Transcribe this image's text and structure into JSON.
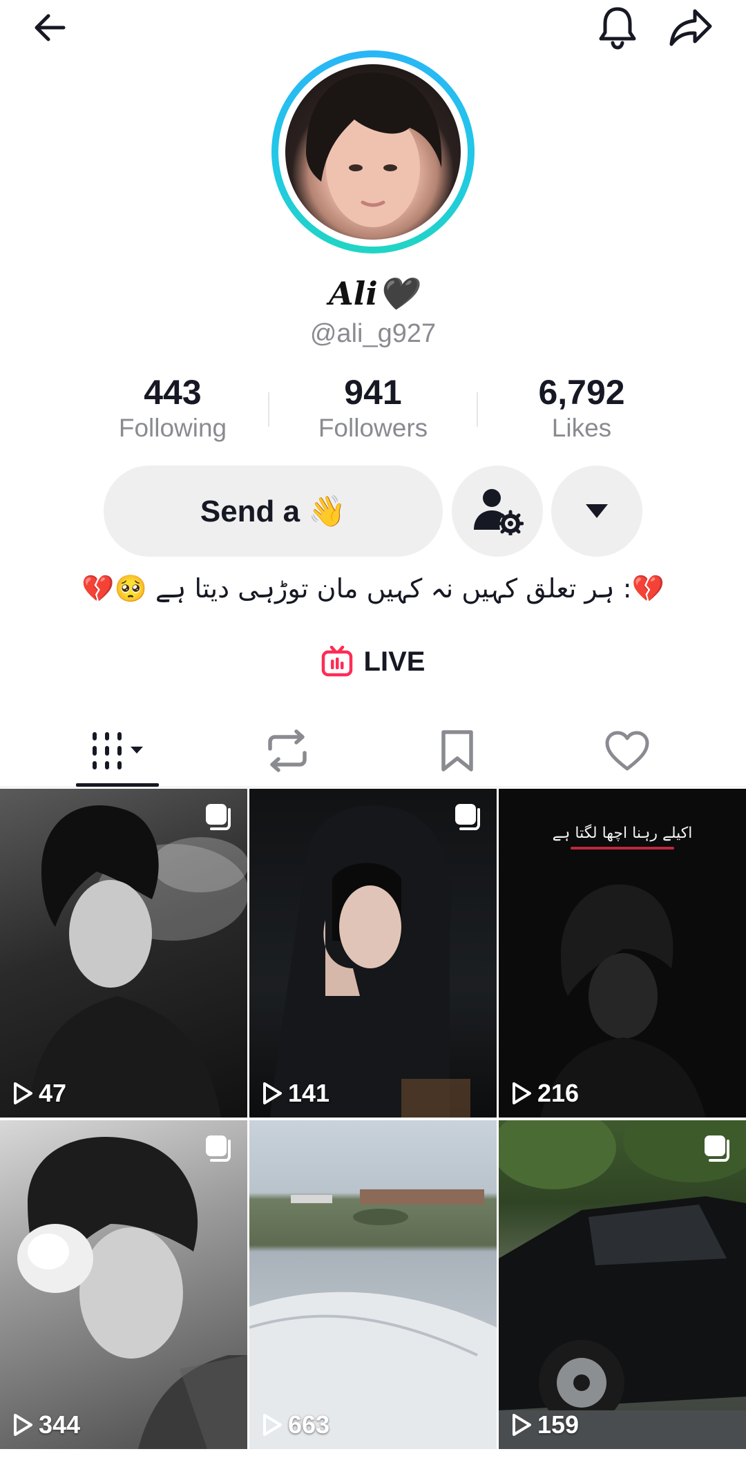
{
  "header": {
    "back_icon": "arrow-left-icon",
    "bell_icon": "bell-icon",
    "share_icon": "share-arrow-icon"
  },
  "profile": {
    "display_name": "Ali🖤",
    "username": "@ali_g927",
    "avatar_ring_colors": [
      "#29b6f6",
      "#20d5c4"
    ]
  },
  "stats": [
    {
      "value": "443",
      "label": "Following"
    },
    {
      "value": "941",
      "label": "Followers"
    },
    {
      "value": "6,792",
      "label": "Likes"
    }
  ],
  "actions": {
    "primary_label": "Send a 👋",
    "profile_settings_icon": "user-gear-icon",
    "more_icon": "caret-down-icon"
  },
  "bio": "💔: ہر تعلق کہیں نہ کہیں مان توڑہی دیتا ہے 🥺💔",
  "live": {
    "label": "LIVE",
    "icon": "live-tv-icon",
    "accent": "#fe2c55"
  },
  "tabs": [
    {
      "name": "videos-grid",
      "icon": "grid-bars-icon",
      "active": true
    },
    {
      "name": "reposts",
      "icon": "repost-icon",
      "active": false
    },
    {
      "name": "favorites",
      "icon": "bookmark-icon",
      "active": false
    },
    {
      "name": "liked",
      "icon": "heart-icon",
      "active": false
    }
  ],
  "videos": [
    {
      "views": "47",
      "multi": true
    },
    {
      "views": "141",
      "multi": true
    },
    {
      "views": "216",
      "multi": false,
      "overlay_urdu": "اکیلے رہنا اچھا لگتا ہے"
    },
    {
      "views": "344",
      "multi": true
    },
    {
      "views": "663",
      "multi": false
    },
    {
      "views": "159",
      "multi": true
    }
  ],
  "colors": {
    "text_primary": "#161823",
    "text_secondary": "#8a8b91",
    "button_bg": "#efeff0"
  }
}
